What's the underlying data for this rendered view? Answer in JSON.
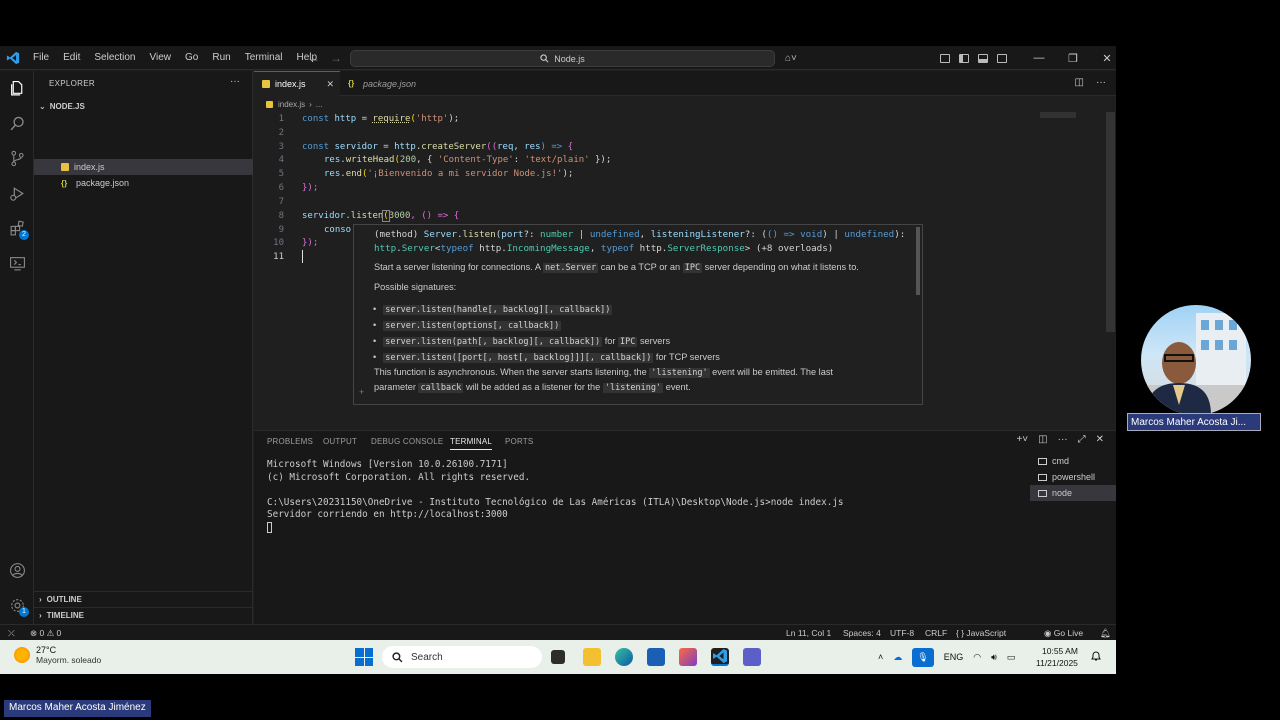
{
  "titlebar": {
    "menu": [
      "File",
      "Edit",
      "Selection",
      "View",
      "Go",
      "Run",
      "Terminal",
      "Help"
    ],
    "command_center": "Node.js"
  },
  "sidebar": {
    "title": "EXPLORER",
    "more": "···",
    "folder": "NODE.JS",
    "files": [
      {
        "label": "index.js"
      },
      {
        "label": "package.json"
      }
    ],
    "outline": "OUTLINE",
    "timeline": "TIMELINE"
  },
  "editor": {
    "tabs": [
      {
        "label": "index.js"
      },
      {
        "label": "package.json"
      }
    ],
    "breadcrumb": [
      "index.js",
      "..."
    ],
    "line_numbers": [
      "1",
      "2",
      "3",
      "4",
      "5",
      "6",
      "7",
      "8",
      "9",
      "10",
      "11"
    ],
    "code": {
      "l1": [
        "const",
        "http",
        "=",
        "require",
        "(",
        "'http'",
        ");"
      ],
      "l3": [
        "const",
        "servidor",
        "=",
        "http",
        ".",
        "createServer",
        "((",
        "req",
        ", ",
        "res",
        ") =>",
        " {"
      ],
      "l4": [
        "res",
        ".",
        "writeHead",
        "(",
        "200",
        ", { ",
        "'Content-Type'",
        ": ",
        "'text/plain'",
        " });"
      ],
      "l5": [
        "res",
        ".",
        "end",
        "(",
        "'¡Bienvenido a mi servidor Node.js!'",
        ");"
      ],
      "l6": "});",
      "l8": [
        "servidor",
        ".",
        "listen",
        "(",
        "3000",
        ", () =>",
        " {"
      ],
      "l9": "conso",
      "l10": "});"
    }
  },
  "hover": {
    "sig1": [
      "(method) ",
      "Server",
      ".",
      "listen",
      "(",
      "port",
      "?: ",
      "number",
      " | ",
      "undefined",
      ", ",
      "listeningListener",
      "?: (",
      "() => void",
      ") | ",
      "undefined",
      "):"
    ],
    "sig2": [
      "http",
      ".",
      "Server",
      "<",
      "typeof",
      " http.",
      "IncomingMessage",
      ", ",
      "typeof",
      " http.",
      "ServerResponse",
      "> (+8 overloads)"
    ],
    "desc1": [
      "Start a server listening for connections. A",
      "net.Server",
      "can be a TCP or an",
      "IPC",
      "server depending on what it listens to."
    ],
    "possible": "Possible signatures:",
    "signatures": [
      {
        "code": "server.listen(handle[, backlog][, callback])",
        "suffix": ""
      },
      {
        "code": "server.listen(options[, callback])",
        "suffix": ""
      },
      {
        "code": "server.listen(path[, backlog][, callback])",
        "mid": "for",
        "code2": "IPC",
        "suffix": "servers"
      },
      {
        "code": "server.listen([port[, host[, backlog]]][, callback])",
        "suffix": "for TCP servers"
      }
    ],
    "desc2": [
      "This function is asynchronous. When the server starts listening, the",
      "'listening'",
      "event will be emitted. The last"
    ],
    "desc3": [
      "parameter",
      "callback",
      "will be added as a listener for the",
      "'listening'",
      "event."
    ]
  },
  "panel": {
    "tabs": [
      "PROBLEMS",
      "OUTPUT",
      "DEBUG CONSOLE",
      "TERMINAL",
      "PORTS"
    ],
    "terminal_lines": [
      "Microsoft Windows [Version 10.0.26100.7171]",
      "(c) Microsoft Corporation. All rights reserved.",
      "",
      "C:\\Users\\20231150\\OneDrive - Instituto Tecnológico de Las Américas (ITLA)\\Desktop\\Node.js>node index.js",
      "Servidor corriendo en http://localhost:3000"
    ],
    "terminals": [
      "cmd",
      "powershell",
      "node"
    ]
  },
  "statusbar": {
    "problems": "⊗ 0 ⚠ 0",
    "position": "Ln 11, Col 1",
    "spaces": "Spaces: 4",
    "encoding": "UTF-8",
    "eol": "CRLF",
    "language": "{ } JavaScript",
    "golive": "Go Live"
  },
  "taskbar": {
    "temp": "27°C",
    "weather": "Mayorm. soleado",
    "search": "Search",
    "lang": "ENG",
    "time": "10:55 AM",
    "date": "11/21/2025"
  },
  "overlay": {
    "name_tag": "Marcos Maher Acosta Ji...",
    "bottom_name": "Marcos Maher Acosta Jiménez"
  },
  "colors": {
    "accent": "#0078d4",
    "editor_bg": "#1f1f1f",
    "sidebar_bg": "#181818",
    "taskbar_bg": "#e8f0e9"
  }
}
